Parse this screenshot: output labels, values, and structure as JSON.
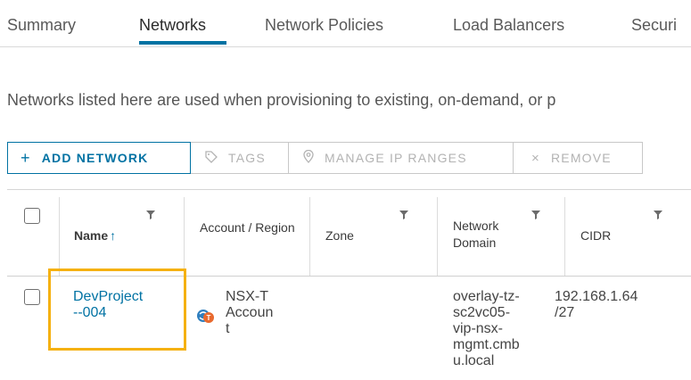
{
  "tabs": [
    {
      "label": "Summary"
    },
    {
      "label": "Networks"
    },
    {
      "label": "Network Policies"
    },
    {
      "label": "Load Balancers"
    },
    {
      "label": "Securi"
    }
  ],
  "active_tab": "Networks",
  "description": "Networks listed here are used when provisioning to existing, on-demand, or p",
  "toolbar": {
    "add_network": "ADD NETWORK",
    "tags": "TAGS",
    "manage_ip_ranges": "MANAGE IP RANGES",
    "remove": "REMOVE"
  },
  "table": {
    "columns": [
      {
        "label": "Name",
        "sort": "ascending"
      },
      {
        "label": "Account / Region"
      },
      {
        "label": "Zone"
      },
      {
        "label": "Network Domain"
      },
      {
        "label": "CIDR"
      }
    ],
    "rows": [
      {
        "name": "DevProject\n--004",
        "account": "NSX-T\nAccoun\nt",
        "zone": "",
        "network_domain": "overlay-tz-\nsc2vc05-\nvip-nsx-\nmgmt.cmb\nu.local",
        "cidr": "192.168.1.64\n/27"
      }
    ]
  },
  "colors": {
    "accent": "#0072a3",
    "highlight": "#f5b111",
    "account_icon_blue": "#2f7fbf",
    "account_icon_orange": "#e8692e"
  },
  "icons": {
    "add": "plus-icon",
    "tags": "tag-icon",
    "ip_ranges": "location-pin-icon",
    "remove": "close-icon",
    "filter": "filter-icon",
    "account": "nsx-account-icon"
  }
}
